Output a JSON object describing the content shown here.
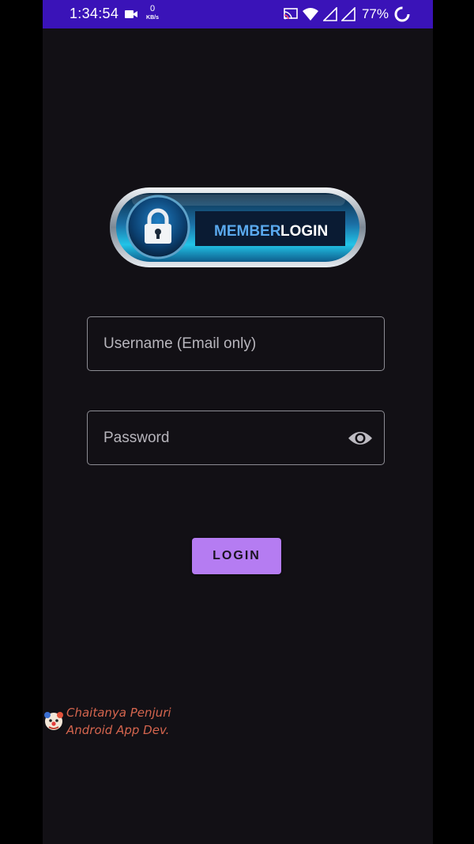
{
  "status_bar": {
    "time": "1:34:54",
    "net_speed_value": "0",
    "net_speed_unit": "KB/s",
    "battery_percent": "77%"
  },
  "logo": {
    "text_member": "MEMBER",
    "text_login": "LOGIN"
  },
  "form": {
    "username_placeholder": "Username (Email only)",
    "password_placeholder": "Password",
    "login_button_label": "LOGIN"
  },
  "watermark": {
    "name": "Chaitanya Penjuri",
    "role": "Android App Dev."
  },
  "colors": {
    "status_bar": "#3a13b8",
    "background": "#121015",
    "button": "#b57cf2",
    "watermark_text": "#d5654e"
  },
  "icons": [
    "video-camera-icon",
    "cast-icon",
    "wifi-icon",
    "signal-icon",
    "battery-loading-icon",
    "lock-icon",
    "eye-icon",
    "clown-avatar-icon"
  ]
}
